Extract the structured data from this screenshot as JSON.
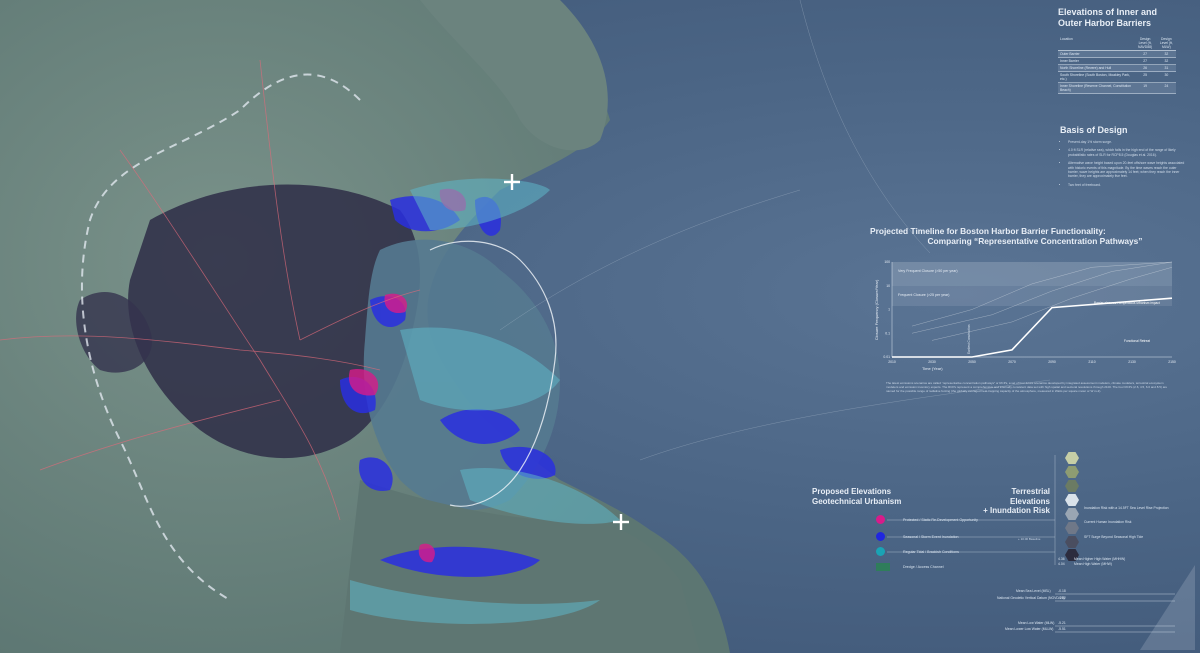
{
  "elevations_table": {
    "title": "Elevations of Inner and Outer Harbor Barriers",
    "columns": [
      "Location",
      "Design Level (ft, NAVD88)",
      "Design Level (ft, MLW)"
    ],
    "rows": [
      {
        "location": "Outer Barrier",
        "navd": "27",
        "mlw": "32"
      },
      {
        "location": "Inner Barrier",
        "navd": "27",
        "mlw": "32"
      },
      {
        "location": "North Shoreline (Revere) and Hull",
        "navd": "26",
        "mlw": "31"
      },
      {
        "location": "South Shoreline (South Boston, Moakley Park, etc.)",
        "navd": "25",
        "mlw": "30"
      },
      {
        "location": "Inner Shoreline (Reserve Channel, Constitution Beach)",
        "navd": "19",
        "mlw": "24"
      }
    ]
  },
  "basis": {
    "title": "Basis of Design",
    "items": [
      "Present-day 1% storm surge.",
      "4.0 ft SLR (relative sea), which falls in the high end of the range of likely probabilistic rates of SLR for RCP8.5 (Douglas et al. 2016).",
      "Alternative wave height based upon 20-feet offshore wave heights associated with historic events of this magnitude. By the time waves reach the outer barrier, wave heights are approximately 14 feet; when they reach the inner barrier, they are approximately five feet.",
      "Two feet of freeboard."
    ]
  },
  "timeline": {
    "title_line1": "Projected Timeline for Boston Harbor Barrier Functionality:",
    "title_line2": "Comparing “Representative Concentration Pathways”",
    "band_very_frequent": "Very Frequent Closure (>50 per year)",
    "band_frequent": "Frequent Closure (>25 per year)",
    "ylabel": "Closure Frequency (Closure/Year)",
    "xlabel": "Time (Year)",
    "annotation_earliest": "Earliest Construction",
    "annotation_closures": "Barrier closures / Amphibious urbanism impact",
    "annotation_functional": "Functional Retreat",
    "caption": "The latest emissions scenarios are called “representative concentration pathways” or RCPs, a set of four future scenarios developed by integrated assessment modelers, climate modelers, terrestrial ecosystem modelers and emission inventory experts. The RCPs represent a comprehensive and internally consistent data set with high spatial and sectoral resolutions through 2100. The four RCPs (2.6, 4.5, 6.0 and 8.5) are named for the possible range of radiative forcing (the globally averaged heat-trapping capacity of the atmosphere, measured in Watts per square meter or W m-2)."
  },
  "chart_data": {
    "type": "line",
    "x": [
      2010,
      2030,
      2050,
      2070,
      2090,
      2110,
      2130,
      2150
    ],
    "xlabel": "Time (Year)",
    "ylabel": "Closure Frequency (Closure/Year)",
    "ytick_labels": [
      "100",
      "10",
      "1",
      "0.1",
      "0.01"
    ],
    "yscale": "log",
    "ylim": [
      0.01,
      100
    ],
    "xlim": [
      2010,
      2150
    ],
    "series": [
      {
        "x": [
          2010,
          2050,
          2070,
          2090,
          2150
        ],
        "y": [
          0.01,
          0.01,
          0.02,
          1.2,
          3
        ]
      },
      {
        "x": [
          2020,
          2050,
          2080,
          2110,
          2150
        ],
        "y": [
          0.2,
          1,
          12,
          60,
          100
        ]
      },
      {
        "x": [
          2020,
          2060,
          2090,
          2120,
          2150
        ],
        "y": [
          0.1,
          0.6,
          6,
          40,
          100
        ]
      },
      {
        "x": [
          2030,
          2070,
          2100,
          2130,
          2150
        ],
        "y": [
          0.05,
          0.3,
          3,
          20,
          60
        ]
      }
    ],
    "grid": false,
    "legend": "none"
  },
  "legend_left": {
    "title_line1": "Proposed Elevations",
    "title_line2": "Geotechnical Urbanism",
    "items": [
      {
        "label": "Protected / Static Re-Development Opportunity",
        "color": "#d81b8a"
      },
      {
        "label": "Seasonal / Storm Event Inundation",
        "color": "#1f26e0"
      },
      {
        "label": "Regular Tidal / Brackish Conditions",
        "color": "#1aa3b4"
      },
      {
        "label": "Dredge / Access Channel",
        "color": "#2f7d5b"
      }
    ]
  },
  "legend_right": {
    "title_line1": "Terrestrial Elevations",
    "title_line2": "+ Inundation Risk",
    "swatches": [
      "#c6cea6",
      "#8e9c72",
      "#6b7b63",
      "#d9e2ea",
      "#9aa6b3",
      "#6f7888",
      "#4a4e60",
      "#2c2c3e"
    ],
    "labels": [
      "Inundation Risk with a 14.5FT Sea Level Rise Projection",
      "Current Human Inundation Risk",
      "SFT Surge Beyond Seasonal High Tide",
      "Mean Higher High Water (MHHW)",
      "Mean High Water (MHW)"
    ],
    "baseline_label": "+ 10.00 Baseline",
    "values": [
      "4.36",
      "4.04"
    ],
    "lower_labels": [
      "Mean Sea Level (MSL)",
      "National Geodetic Vertical Datum (NGVD 29)",
      "Mean Low Water (MLW)",
      "Mean Lower Low Water (MLLW)"
    ],
    "lower_values": [
      "-0.18",
      "-0.82",
      "-5.21",
      "-5.51"
    ]
  },
  "colors": {
    "ocean": "#4b6585",
    "land": "#6f8a84",
    "urban": "#2c2a45",
    "magenta": "#d81b8a",
    "blue": "#1f26e0",
    "teal": "#1aa3b4",
    "road": "#e06a7a"
  }
}
